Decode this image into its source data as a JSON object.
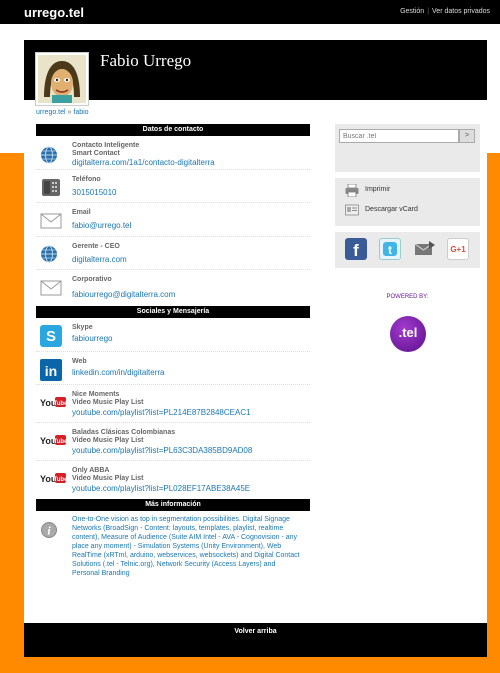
{
  "topbar": {
    "brand": "urrego.tel",
    "links": [
      "Gestión",
      "Ver datos privados"
    ]
  },
  "profile": {
    "name": "Fabio Urrego"
  },
  "breadcrumb": {
    "home": "urrego.tel",
    "separator": "»",
    "current": "fabio"
  },
  "contact": {
    "heading": "Datos de contacto",
    "items": [
      {
        "title": "Contacto Inteligente\nSmart Contact",
        "value": "digitalterra.com/1a1/contacto-digitalterra",
        "icon": "globe-icon"
      },
      {
        "title": "Teléfono",
        "value": "3015015010",
        "icon": "phone-icon"
      },
      {
        "title": "Email",
        "value": "fabio@urrego.tel",
        "icon": "envelope-icon"
      },
      {
        "title": "Gerente - CEO",
        "value": "digitalterra.com",
        "icon": "globe-icon"
      },
      {
        "title": "Corporativo",
        "value": "fabiourrego@digitalterra.com",
        "icon": "envelope-icon"
      }
    ]
  },
  "social": {
    "heading": "Sociales y Mensajería",
    "items": [
      {
        "title": "Skype",
        "value": "fabiourrego",
        "icon": "skype-icon"
      },
      {
        "title": "Web",
        "value": "linkedin.com/in/digitalterra",
        "icon": "linkedin-icon"
      },
      {
        "title": "Nice Moments\nVideo Music Play List",
        "value": "youtube.com/playlist?list=PL214E87B2848CEAC1",
        "icon": "youtube-icon"
      },
      {
        "title": "Baladas Clásicas Colombianas\nVideo Music Play List",
        "value": "youtube.com/playlist?list=PL63C3DA385BD9AD08",
        "icon": "youtube-icon"
      },
      {
        "title": "Only ABBA\nVideo Music Play List",
        "value": "youtube.com/playlist?list=PL028EF17ABE38A45E",
        "icon": "youtube-icon"
      }
    ]
  },
  "more": {
    "heading": "Más información",
    "text": "One-to-One vision as top in segmentation possibilities. Digital Signage Networks (BroadSign - Content: layouts, templates, playlist, realtime content), Measure of Audience (Suite AIM Intel - AVA - Cognovision - any place any moment) - Simulation Systems (Unity Environment), Web RealTime (xRTml, arduino, webservices, websockets) and Digital Contact Solutions (.tel - Telnic.org), Network Security (Access Layers) and Personal Branding",
    "icon": "info-icon"
  },
  "sidebar": {
    "search_placeholder": "Buscar .tel",
    "search_button": ">",
    "print_label": "Imprimir",
    "vcard_label": "Descargar vCard",
    "powered_by": "POWERED BY:",
    "tel_logo": ".tel",
    "social_buttons": [
      "facebook-icon",
      "twitter-icon",
      "mail-share-icon",
      "google-plus-icon"
    ],
    "gplus_label": "G+1"
  },
  "footer": {
    "back_to_top": "Volver arriba"
  },
  "colors": {
    "orange": "#ff8a00",
    "link": "#1a77b4",
    "purple": "#6a1a9a"
  }
}
